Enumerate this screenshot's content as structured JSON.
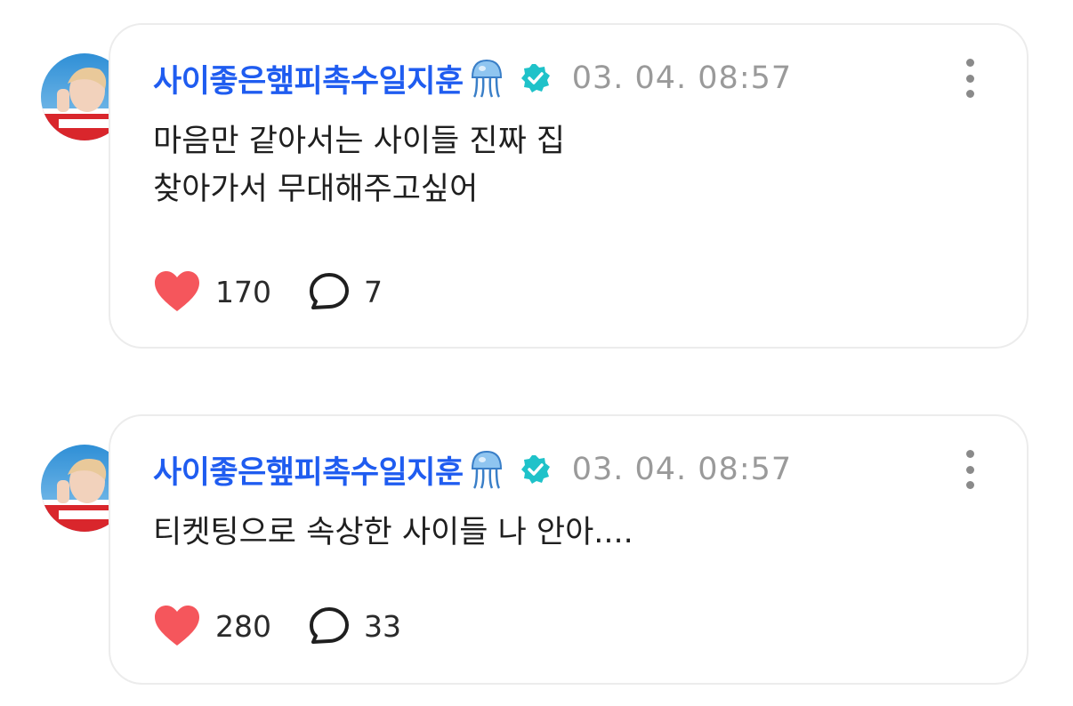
{
  "posts": [
    {
      "author": "사이좋은햎피촉수일지훈",
      "timestamp": "03. 04. 08:57",
      "lines": [
        "마음만 같아서는 사이들 진짜 집",
        "찾아가서 무대해주고싶어"
      ],
      "likes": "170",
      "comments": "7"
    },
    {
      "author": "사이좋은햎피촉수일지훈",
      "timestamp": "03. 04. 08:57",
      "lines": [
        "티켓팅으로 속상한 사이들 나 안아...."
      ],
      "likes": "280",
      "comments": "33"
    }
  ],
  "icons": {
    "jellyfish": "jellyfish-emoji-icon",
    "verified": "verified-badge-icon",
    "like": "heart-icon",
    "comment": "speech-bubble-icon",
    "more": "more-vertical-icon"
  },
  "colors": {
    "author": "#1f5cf0",
    "verified": "#1fc2c9",
    "heart": "#f5565c",
    "timestamp": "#9a9a9a",
    "card_border": "#ececec"
  }
}
